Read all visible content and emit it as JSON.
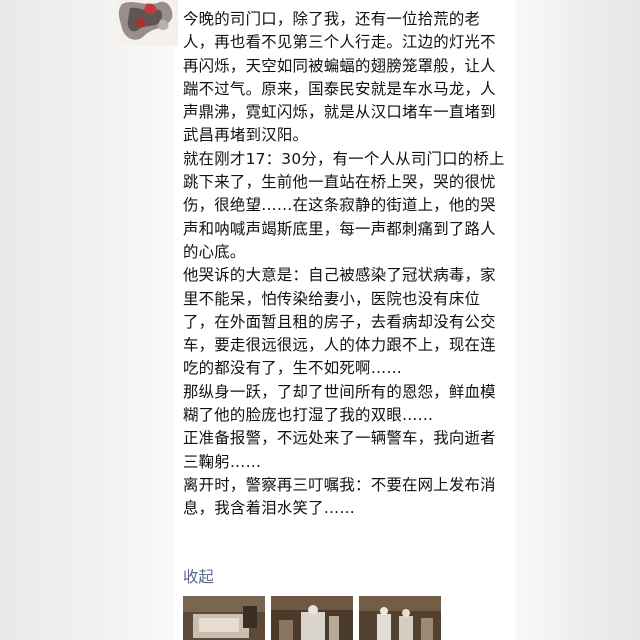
{
  "post": {
    "paragraphs": [
      "今晚的司门口，除了我，还有一位拾荒的老人，再也看不见第三个人行走。江边的灯光不再闪烁，天空如同被蝙蝠的翅膀笼罩般，让人踹不过气。原来，国泰民安就是车水马龙，人声鼎沸，霓虹闪烁，就是从汉口堵车一直堵到武昌再堵到汉阳。",
      "就在刚才17：30分，有一个人从司门口的桥上跳下来了，生前他一直站在桥上哭，哭的很忧伤，很绝望……在这条寂静的街道上，他的哭声和呐喊声竭斯底里，每一声都刺痛到了路人的心底。",
      "他哭诉的大意是：自己被感染了冠状病毒，家里不能呆，怕传染给妻小，医院也没有床位了，在外面暂且租的房子，去看病却没有公交车，要走很远很远，人的体力跟不上，现在连吃的都没有了，生不如死啊……",
      "那纵身一跃，了却了世间所有的恩怨，鲜血模糊了他的脸庞也打湿了我的双眼……",
      "正准备报警，不远处来了一辆警车，我向逝者三鞠躬……",
      "离开时，警察再三叮嘱我：不要在网上发布消息，我含着泪水笑了……"
    ],
    "collapse_label": "收起"
  },
  "colors": {
    "text": "#111111",
    "link": "#56658c",
    "background": "#ffffff"
  }
}
